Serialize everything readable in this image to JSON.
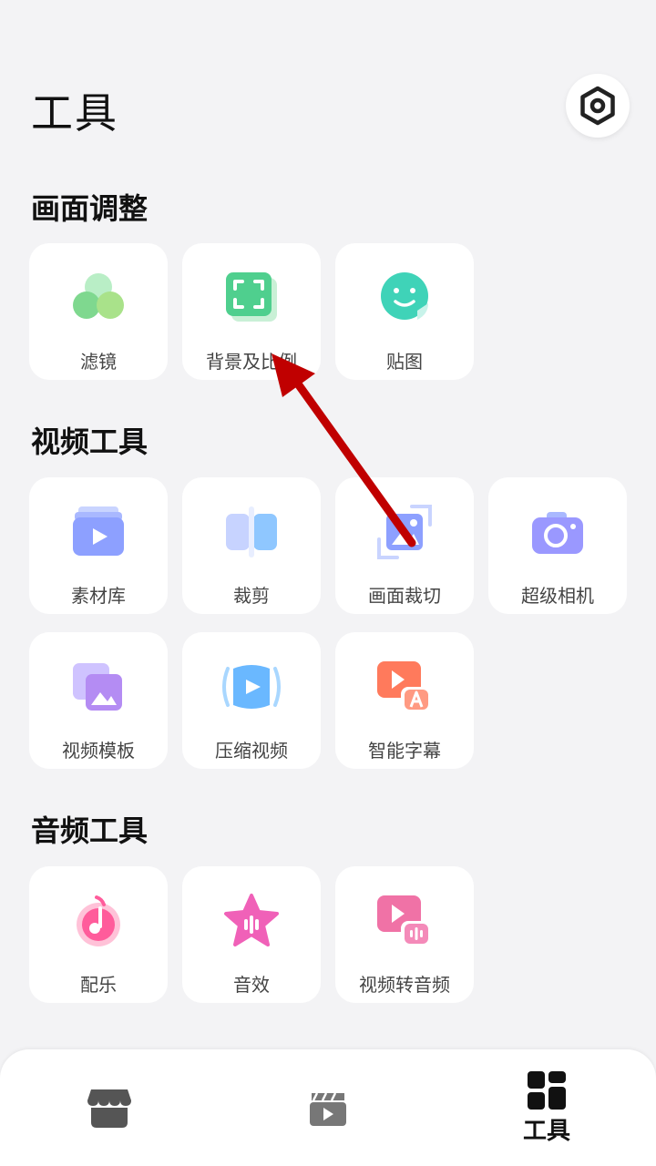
{
  "header": {
    "title": "工具"
  },
  "sections": {
    "picture": {
      "title": "画面调整",
      "items": [
        "滤镜",
        "背景及比例",
        "贴图"
      ]
    },
    "video": {
      "title": "视频工具",
      "items": [
        "素材库",
        "裁剪",
        "画面裁切",
        "超级相机",
        "视频模板",
        "压缩视频",
        "智能字幕"
      ]
    },
    "audio": {
      "title": "音频工具",
      "items": [
        "配乐",
        "音效",
        "视频转音频"
      ]
    }
  },
  "bottom_nav": {
    "tools_label": "工具",
    "icons": [
      "store-icon",
      "video-clip-icon",
      "tools-grid-icon"
    ]
  },
  "colors": {
    "background": "#f3f3f5",
    "tile": "#ffffff",
    "annotation_arrow": "#c00000"
  }
}
